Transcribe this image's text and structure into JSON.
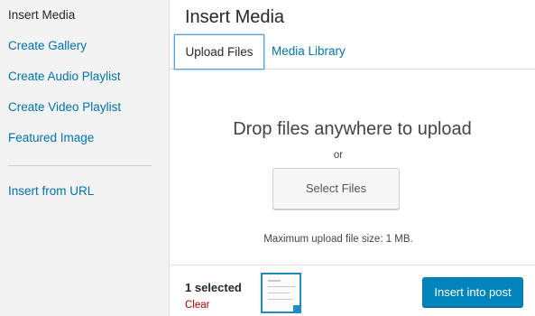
{
  "sidebar": {
    "items": [
      {
        "label": "Insert Media"
      },
      {
        "label": "Create Gallery"
      },
      {
        "label": "Create Audio Playlist"
      },
      {
        "label": "Create Video Playlist"
      },
      {
        "label": "Featured Image"
      },
      {
        "label": "Insert from URL"
      }
    ]
  },
  "main": {
    "title": "Insert Media",
    "tabs": [
      {
        "label": "Upload Files"
      },
      {
        "label": "Media Library"
      }
    ],
    "drop_title": "Drop files anywhere to upload",
    "or_text": "or",
    "select_button": "Select Files",
    "max_upload": "Maximum upload file size: 1 MB."
  },
  "toolbar": {
    "selected_count": "1 selected",
    "clear_label": "Clear",
    "insert_button": "Insert into post"
  },
  "colors": {
    "accent": "#0073aa",
    "primary_button": "#0085ba",
    "clear_link": "#aa0000",
    "sidebar_bg": "#f3f3f3"
  }
}
